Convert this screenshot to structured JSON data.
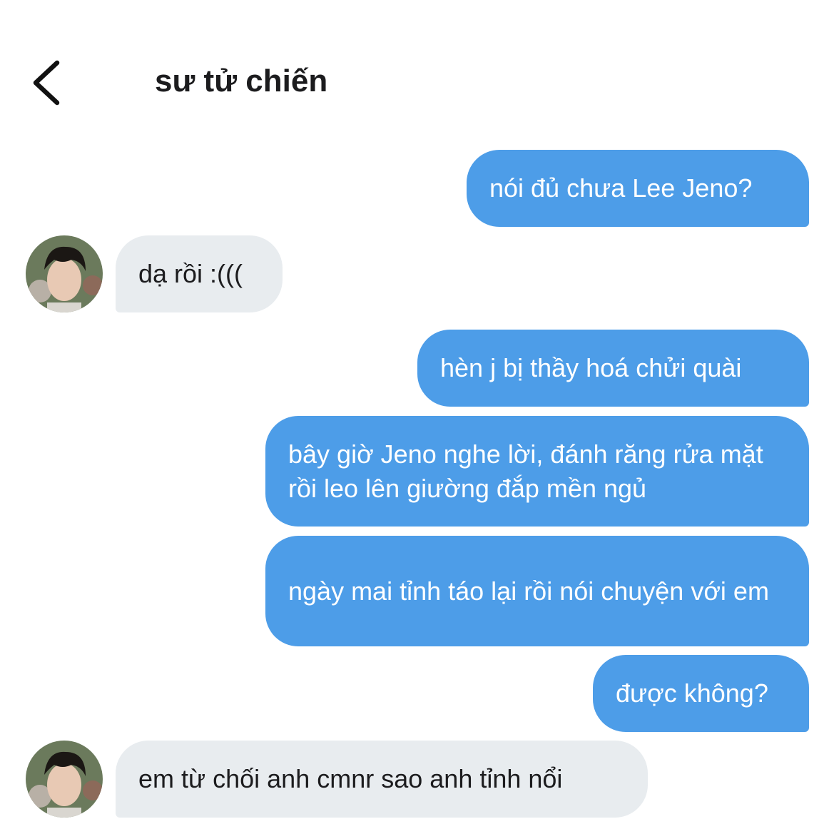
{
  "header": {
    "title": "sư tử chiến",
    "back_icon": "chevron-left-icon"
  },
  "messages": [
    {
      "side": "out",
      "text": "nói đủ chưa Lee Jeno?"
    },
    {
      "side": "in",
      "text": "dạ rồi :((("
    },
    {
      "side": "out",
      "text": "hèn j bị thầy hoá chửi quài"
    },
    {
      "side": "out",
      "text": "bây giờ Jeno nghe lời, đánh răng rửa mặt rồi leo lên giường đắp mền ngủ"
    },
    {
      "side": "out",
      "text": "ngày mai tỉnh táo lại rồi nói chuyện với em"
    },
    {
      "side": "out",
      "text": "được không?"
    },
    {
      "side": "in",
      "text": "em từ chối anh cmnr sao anh tỉnh nổi"
    }
  ],
  "colors": {
    "outgoing_bubble": "#4d9de8",
    "incoming_bubble": "#e8ecef",
    "title_text": "#1c1c1e"
  }
}
